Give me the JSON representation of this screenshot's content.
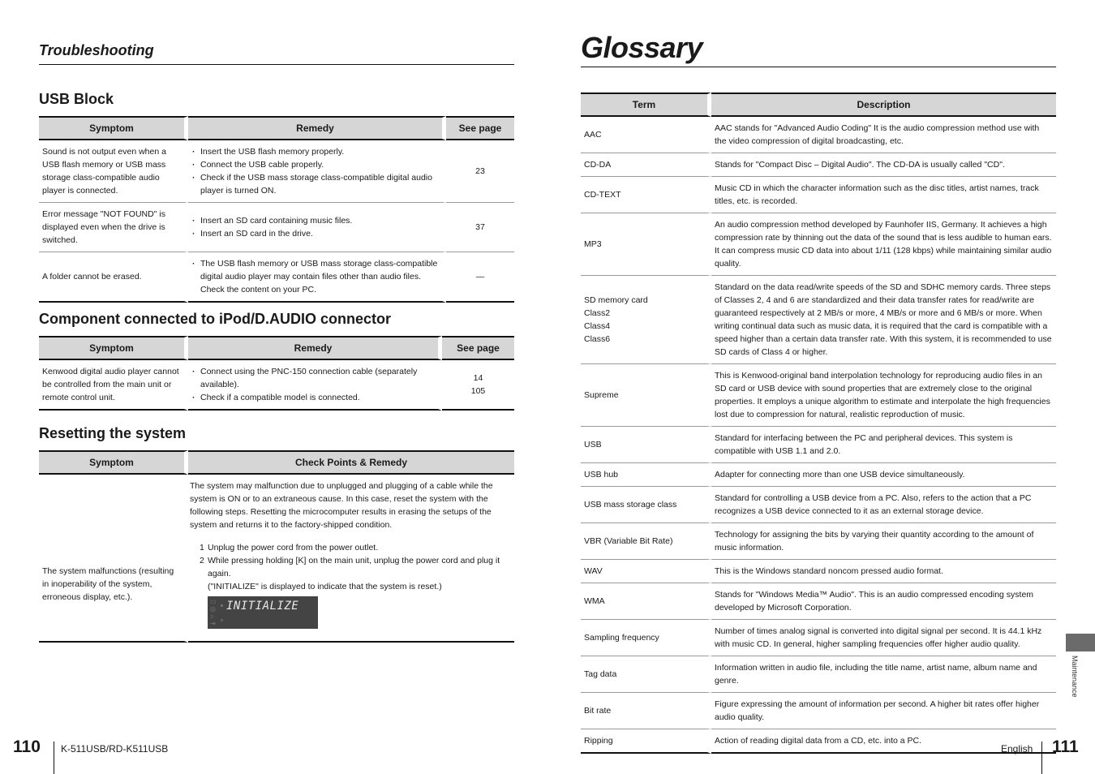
{
  "left_page": {
    "running_head": "Troubleshooting",
    "usb_block": {
      "title": "USB Block",
      "headers": [
        "Symptom",
        "Remedy",
        "See page"
      ],
      "rows": [
        {
          "symptom": "Sound is not output even when a USB flash memory or USB mass storage class-compatible audio player is connected.",
          "remedy": [
            "Insert the USB flash memory properly.",
            "Connect the USB cable properly.",
            "Check if the USB mass storage class-compatible digital audio player is turned ON."
          ],
          "page": "23"
        },
        {
          "symptom": "Error message \"NOT FOUND\" is displayed even when the drive is switched.",
          "remedy": [
            "Insert an SD card containing music files.",
            "Insert an SD card in the drive."
          ],
          "page": "37"
        },
        {
          "symptom": "A folder cannot be erased.",
          "remedy": [
            "The USB flash memory or USB mass storage class-compatible digital audio player may contain files other than audio files. Check the content on your PC."
          ],
          "page": "—"
        }
      ]
    },
    "ipod_block": {
      "title": "Component connected to iPod/D.AUDIO connector",
      "headers": [
        "Symptom",
        "Remedy",
        "See page"
      ],
      "rows": [
        {
          "symptom": "Kenwood digital audio player cannot be controlled from the main unit or remote control unit.",
          "remedy": [
            "Connect using the PNC-150 connection cable (separately available).",
            "Check if a compatible model is connected."
          ],
          "page_lines": [
            "14",
            "105"
          ]
        }
      ]
    },
    "reset_block": {
      "title": "Resetting the system",
      "headers": [
        "Symptom",
        "Check Points & Remedy"
      ],
      "symptom": "The system malfunctions (resulting in inoperability of the system, erroneous display, etc.).",
      "intro": "The system may malfunction due to unplugged and plugging of a cable while the system is ON or to an extraneous cause. In this case, reset the system with the following steps. Resetting the microcomputer results in erasing the setups of the system and returns it to the factory-shipped condition.",
      "steps": [
        {
          "num": "1",
          "text": "Unplug the power cord from the power outlet."
        },
        {
          "num": "2",
          "text": "While pressing holding [K] on the main unit, unplug the power cord and plug it again."
        }
      ],
      "note": "(\"INITIALIZE\" is displayed to indicate that the system is reset.)",
      "display_text": "INITIALIZE"
    },
    "footer": {
      "page_number": "110",
      "model": "K-511USB/RD-K511USB"
    }
  },
  "right_page": {
    "title": "Glossary",
    "headers": [
      "Term",
      "Description"
    ],
    "rows": [
      {
        "term": "AAC",
        "desc": "AAC stands for \"Advanced Audio Coding\" It is the audio compression method use with the video compression of digital broadcasting, etc."
      },
      {
        "term": "CD-DA",
        "desc": "Stands for \"Compact Disc – Digital Audio\". The CD-DA is usually called \"CD\"."
      },
      {
        "term": "CD-TEXT",
        "desc": "Music CD in which the character information such as the disc titles, artist names, track titles, etc. is recorded."
      },
      {
        "term": "MP3",
        "desc": "An audio compression method developed by Faunhofer IIS, Germany. It achieves a high compression rate by thinning out the data of the sound that is less audible to human ears. It can compress music CD data into about 1/11 (128 kbps) while maintaining similar audio quality."
      },
      {
        "term_lines": [
          "SD memory card",
          "Class2",
          "Class4",
          "Class6"
        ],
        "desc": "Standard on the data read/write speeds of the SD and SDHC memory cards. Three steps of Classes 2, 4 and 6 are standardized and their data transfer rates for read/write are guaranteed respectively at 2 MB/s or more, 4 MB/s or more and 6 MB/s or more. When writing continual data such as music data, it is required that the card is compatible with a speed higher than a certain data transfer rate. With this system, it is recommended to use SD cards of Class 4 or higher."
      },
      {
        "term": "Supreme",
        "desc": "This is Kenwood-original band interpolation technology for reproducing audio files in an SD card or USB device with sound properties that are extremely close to the original properties. It employs a unique algorithm to estimate and interpolate the high frequencies lost due to compression for natural, realistic reproduction of music."
      },
      {
        "term": "USB",
        "desc": "Standard for interfacing between the PC and peripheral devices. This system is compatible with USB 1.1 and 2.0."
      },
      {
        "term": "USB hub",
        "desc": "Adapter for connecting more than one USB device simultaneously."
      },
      {
        "term": "USB mass storage class",
        "desc": "Standard for controlling a USB device from a PC. Also, refers to the action that a PC recognizes a USB device connected to it as an external storage device."
      },
      {
        "term": "VBR (Variable Bit Rate)",
        "desc": "Technology for assigning the bits by varying their quantity according to the amount of music information."
      },
      {
        "term": "WAV",
        "desc": "This is the Windows standard noncom pressed audio format."
      },
      {
        "term": "WMA",
        "desc": "Stands for \"Windows Media™ Audio\". This is an audio compressed encoding system developed by Microsoft Corporation."
      },
      {
        "term": "Sampling frequency",
        "desc": "Number of times analog signal is converted into digital signal per second. It is 44.1 kHz with music CD. In general, higher sampling frequencies offer higher audio quality."
      },
      {
        "term": "Tag data",
        "desc": "Information written in audio file, including the title name, artist name, album name and genre."
      },
      {
        "term": "Bit rate",
        "desc": "Figure expressing the amount of information per second. A higher bit rates offer higher audio quality."
      },
      {
        "term": "Ripping",
        "desc": "Action of reading digital data from a CD, etc. into a PC."
      }
    ],
    "side_tab_label": "Maintenance",
    "footer": {
      "language": "English",
      "page_number": "111"
    }
  }
}
